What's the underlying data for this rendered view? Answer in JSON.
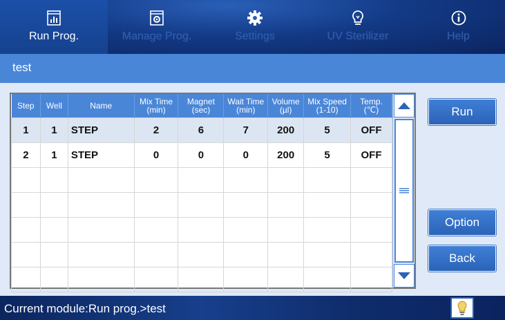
{
  "tabs": [
    {
      "label": "Run Prog.",
      "icon": "chart-icon",
      "active": true
    },
    {
      "label": "Manage Prog.",
      "icon": "program-icon",
      "active": false
    },
    {
      "label": "Settings",
      "icon": "gear-icon",
      "active": false
    },
    {
      "label": "UV Sterilizer",
      "icon": "lightbulb-icon",
      "active": false
    },
    {
      "label": "Help",
      "icon": "info-icon",
      "active": false
    }
  ],
  "title": "test",
  "table": {
    "headers": [
      {
        "l1": "Step",
        "l2": ""
      },
      {
        "l1": "Well",
        "l2": ""
      },
      {
        "l1": "Name",
        "l2": ""
      },
      {
        "l1": "Mix Time",
        "l2": "(min)"
      },
      {
        "l1": "Magnet",
        "l2": "(sec)"
      },
      {
        "l1": "Wait Time",
        "l2": "(min)"
      },
      {
        "l1": "Volume",
        "l2": "(µl)"
      },
      {
        "l1": "Mix Speed",
        "l2": "(1-10)"
      },
      {
        "l1": "Temp.",
        "l2": "(℃)"
      }
    ],
    "rows": [
      [
        "1",
        "1",
        "STEP",
        "2",
        "6",
        "7",
        "200",
        "5",
        "OFF"
      ],
      [
        "2",
        "1",
        "STEP",
        "0",
        "0",
        "0",
        "200",
        "5",
        "OFF"
      ]
    ]
  },
  "buttons": {
    "run": "Run",
    "option": "Option",
    "back": "Back"
  },
  "status": "Current module:Run prog.>test",
  "colors": {
    "accent": "#4a86d8",
    "header_dark": "#133a86",
    "selected_row": "#dce6f2"
  }
}
